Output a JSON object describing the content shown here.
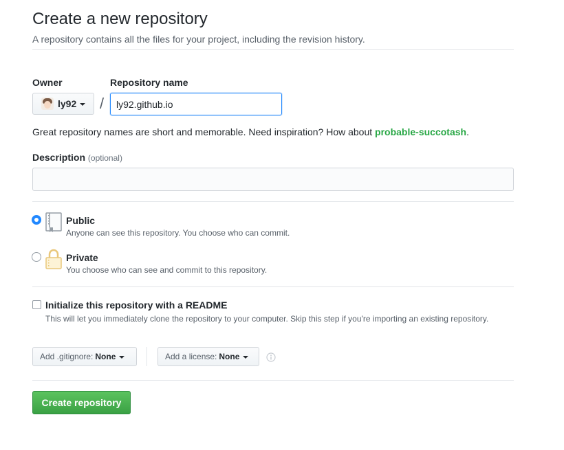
{
  "header": {
    "title": "Create a new repository",
    "subtitle": "A repository contains all the files for your project, including the revision history."
  },
  "owner": {
    "label": "Owner",
    "value": "ly92"
  },
  "separator": "/",
  "repo": {
    "label": "Repository name",
    "value": "ly92.github.io"
  },
  "hint": {
    "text": "Great repository names are short and memorable. Need inspiration? How about ",
    "suggestion": "probable-succotash",
    "end": "."
  },
  "description": {
    "label": "Description",
    "optional": "(optional)",
    "value": ""
  },
  "visibility": {
    "selected": "public",
    "public": {
      "title": "Public",
      "desc": "Anyone can see this repository. You choose who can commit."
    },
    "private": {
      "title": "Private",
      "desc": "You choose who can see and commit to this repository."
    }
  },
  "readme": {
    "checked": false,
    "title": "Initialize this repository with a README",
    "desc": "This will let you immediately clone the repository to your computer. Skip this step if you're importing an existing repository."
  },
  "gitignore": {
    "label": "Add .gitignore:",
    "value": "None"
  },
  "license": {
    "label": "Add a license:",
    "value": "None"
  },
  "icons": {
    "owner_caret": "caret-down-icon",
    "public": "repo-book-icon",
    "private": "lock-icon",
    "info": "info-icon"
  },
  "colors": {
    "accent_blue": "#2188ff",
    "suggestion_green": "#28a745",
    "create_button": "#3aa144"
  },
  "submit": {
    "label": "Create repository"
  }
}
